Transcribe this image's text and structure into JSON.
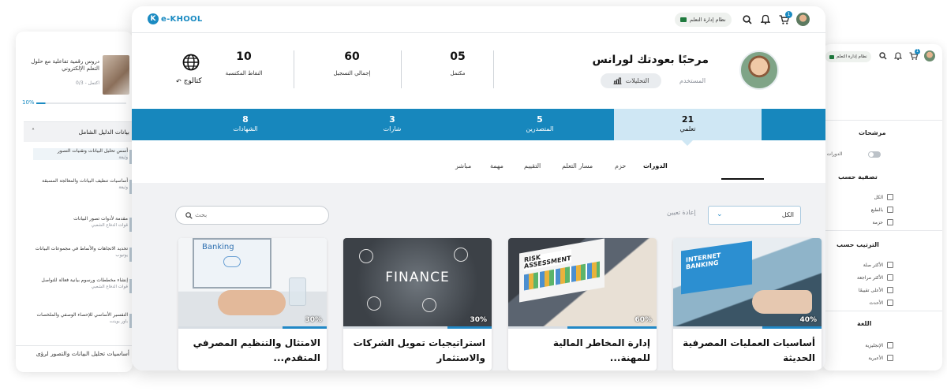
{
  "left_panel": {
    "course_title": "دروس رقمية تفاعلية مع حلول التعلم الإلكتروني",
    "course_meta": "اكتمل - 0/3",
    "progress_label": "10%",
    "progress": 0.1,
    "section_title": "بيانات الدليل الشامل",
    "items": [
      {
        "title": "أسس تحليل البيانات وتقنيات التصور",
        "sub": "وثيقة"
      },
      {
        "title": "أساسيات تنظيف البيانات والمعالجة المسبقة",
        "sub": "وثيقة"
      },
      {
        "title": "مقدمة لأدوات تصور البيانات",
        "sub": "قوات الدفاع الشعبي"
      },
      {
        "title": "تحديد الاتجاهات والأنماط في مجموعات البيانات",
        "sub": "يوتيوب"
      },
      {
        "title": "إنشاء مخططات ورسوم بيانية فعالة للتواصل",
        "sub": "قوات الدفاع الشعبي"
      },
      {
        "title": "التفسير الأساسي للإحصاء الوصفي والملخصات",
        "sub": "باور بوينت"
      }
    ],
    "footer_title": "أساسيات تحليل البيانات والتصور لرؤى"
  },
  "right_panel": {
    "lms_badge": "نظام إدارة التعلم",
    "cart_count": "1",
    "filters_title": "مرشحات",
    "toggle_label": "الدورات ا",
    "filter_by": "تصفية حسب",
    "filter_options": [
      "الكل",
      "بالطبع",
      "حزمة"
    ],
    "sort_by": "الترتيب حسب",
    "sort_options": [
      "الأكثر صلة",
      "الأكثر مراجعة",
      "الأعلى تقييمًا",
      "الأحدث"
    ],
    "language": "اللغة",
    "language_options": [
      "الإنجليزية",
      "الأعبرية"
    ]
  },
  "header": {
    "logo": "e-KHOOL",
    "lms_badge": "نظام إدارة التعلم",
    "cart_count": "1"
  },
  "profile": {
    "greeting": "مرحبًا بعودتك لورانس",
    "role": "المستخدم",
    "analytics_button": "التحليلات",
    "stats": [
      {
        "value": "05",
        "label": "مكتمل"
      },
      {
        "value": "60",
        "label": "إجمالي التسجيل"
      },
      {
        "value": "10",
        "label": "النقاط المكتسبة"
      }
    ],
    "catalog_label": "كتالوج"
  },
  "band_tabs": [
    {
      "count": "21",
      "label": "تعلمي",
      "active": true
    },
    {
      "count": "5",
      "label": "المتصدرين"
    },
    {
      "count": "3",
      "label": "شارات"
    },
    {
      "count": "8",
      "label": "الشهادات"
    }
  ],
  "filter_tabs": [
    "الدورات",
    "حزم",
    "مسار التعلم",
    "التقييم",
    "مهمة",
    "مباشر"
  ],
  "toolbar": {
    "search_placeholder": "بحث",
    "reset_label": "إعادة تعيين",
    "select_value": "الكل"
  },
  "courses": [
    {
      "title": "أساسيات العمليات المصرفية الحديثة",
      "progress_label": "40%",
      "progress": 0.4,
      "image_text": "INTERNET BANKING"
    },
    {
      "title": "إدارة المخاطر المالية للمهنة...",
      "progress_label": "60%",
      "progress": 0.6,
      "image_text": "RISK ASSESSMENT"
    },
    {
      "title": "استراتيجيات تمويل الشركات والاستثمار",
      "progress_label": "30%",
      "progress": 0.3,
      "image_text": "FINANCE"
    },
    {
      "title": "الامتثال والتنظيم المصرفي المتقدم...",
      "progress_label": "30%",
      "progress": 0.3,
      "image_text": "Banking"
    }
  ],
  "colors": {
    "brand": "#1b8bc2",
    "band": "#1787bd",
    "active_tab": "#cfe7f4"
  }
}
